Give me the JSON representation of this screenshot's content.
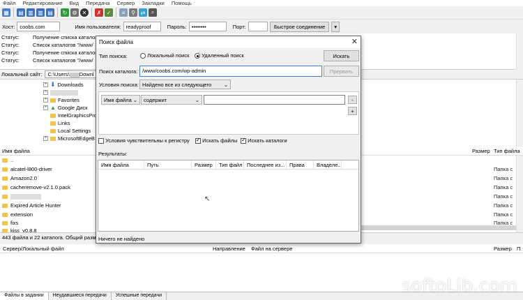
{
  "menu": [
    "Файл",
    "Редактирование",
    "Вид",
    "Передача",
    "Сервер",
    "Закладки",
    "Помощь"
  ],
  "quickconnect": {
    "host_label": "Хост:",
    "host": "coobs.com",
    "user_label": "Имя пользователя:",
    "user": "readyproof",
    "pass_label": "Пароль:",
    "pass": "••••••••",
    "port_label": "Порт:",
    "port": "",
    "connect": "Быстрое соединение"
  },
  "log": [
    {
      "k": "Статус:",
      "v": "Получение списка каталог"
    },
    {
      "k": "Статус:",
      "v": "Список каталогов \"/www/"
    },
    {
      "k": "Статус:",
      "v": "Получение списка каталог"
    },
    {
      "k": "Статус:",
      "v": "Список каталогов \"/www/"
    }
  ],
  "local": {
    "label": "Локальный сайт:",
    "path": "C:\\Users\\",
    "path_end": "Downl"
  },
  "tree": [
    "Downloads",
    "",
    "Favorites",
    "Google Диск",
    "IntelGraphicsPro",
    "Links",
    "Local Settings",
    "MicrosoftEdgeB"
  ],
  "files": {
    "header_name": "Имя файла",
    "header_size": "Размер",
    "header_type": "Тип файла",
    "rows": [
      "..",
      "alcatel-l800-driver",
      "Amazon2.0",
      "cacheremove-v2.1.0.pack",
      "",
      "Expired Article Hunter",
      "extension",
      "fixs",
      "kiss_v0.8.8"
    ],
    "types": [
      "Папка с",
      "Папка с",
      "Папка с",
      "Папка с",
      "Папка с",
      "Папка с",
      "Папка с"
    ]
  },
  "status_line": "443 файла и 22 каталога. Общий разме",
  "queue": {
    "c1": "Сервер/Локальный файл",
    "c2": "Направление",
    "c3": "Файл на сервере",
    "c4": "Размер",
    "c5": "П"
  },
  "tabs": [
    "Файлы в задании",
    "Неудавшиеся передачи",
    "Успешные передачи"
  ],
  "dialog": {
    "title": "Поиск файла",
    "search_type_label": "Тип поиска:",
    "local_search": "Локальный поиск",
    "remote_search": "Удаленный поиск",
    "search_button": "Искать",
    "dir_label": "Поиск каталога:",
    "dir_value": "/www/coobs.com/wp-admin",
    "stop_button": "Прервать",
    "conditions_label": "Условия поиска:",
    "conditions_value": "Найдено все из следующего",
    "filter_field": "Имя файла",
    "filter_op": "содержит",
    "filter_value": "",
    "minus": "-",
    "plus": "+",
    "case_sensitive": "Условия чувствительны к регистру",
    "find_files": "Искать файлы",
    "find_dirs": "Искать каталоги",
    "results_label": "Результаты:",
    "cols": [
      "Имя файла",
      "Путь",
      "Размер",
      "Тип файл",
      "Последнее из...",
      "Права",
      "Владеле..."
    ],
    "status": "Ничего не найдено"
  },
  "watermark": "softoLib.com"
}
